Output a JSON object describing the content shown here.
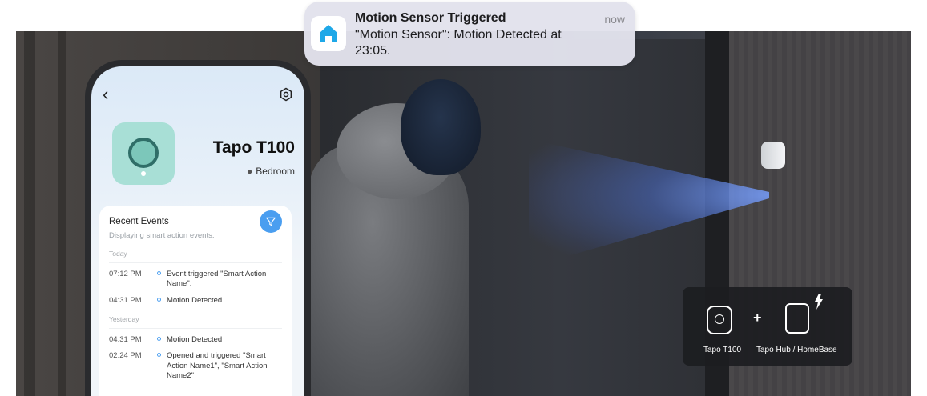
{
  "notification": {
    "title": "Motion Sensor Triggered",
    "body": "\"Motion Sensor\": Motion Detected at 23:05.",
    "time": "now",
    "app_icon": "home-app-icon"
  },
  "app": {
    "nav": {
      "back_icon": "chevron-left-icon",
      "settings_icon": "gear-icon"
    },
    "device": {
      "name": "Tapo T100",
      "location": "Bedroom"
    },
    "events": {
      "title": "Recent Events",
      "subtitle": "Displaying smart action events.",
      "filter_icon": "filter-icon",
      "groups": [
        {
          "day": "Today",
          "items": [
            {
              "time": "07:12 PM",
              "text": "Event triggered \"Smart Action Name\"."
            },
            {
              "time": "04:31 PM",
              "text": "Motion Detected"
            }
          ]
        },
        {
          "day": "Yesterday",
          "items": [
            {
              "time": "04:31 PM",
              "text": "Motion Detected"
            },
            {
              "time": "02:24 PM",
              "text": "Opened and triggered \"Smart Action Name1\", \"Smart Action Name2\""
            }
          ]
        }
      ]
    }
  },
  "compatibility": {
    "item1_label": "Tapo T100",
    "plus": "+",
    "item2_label": "Tapo Hub / HomeBase"
  },
  "colors": {
    "accent": "#4a9ef0",
    "device_tile": "#a8dfd6",
    "notification_bg": "#e2e2ec",
    "panel_bg": "#1c1d21"
  }
}
